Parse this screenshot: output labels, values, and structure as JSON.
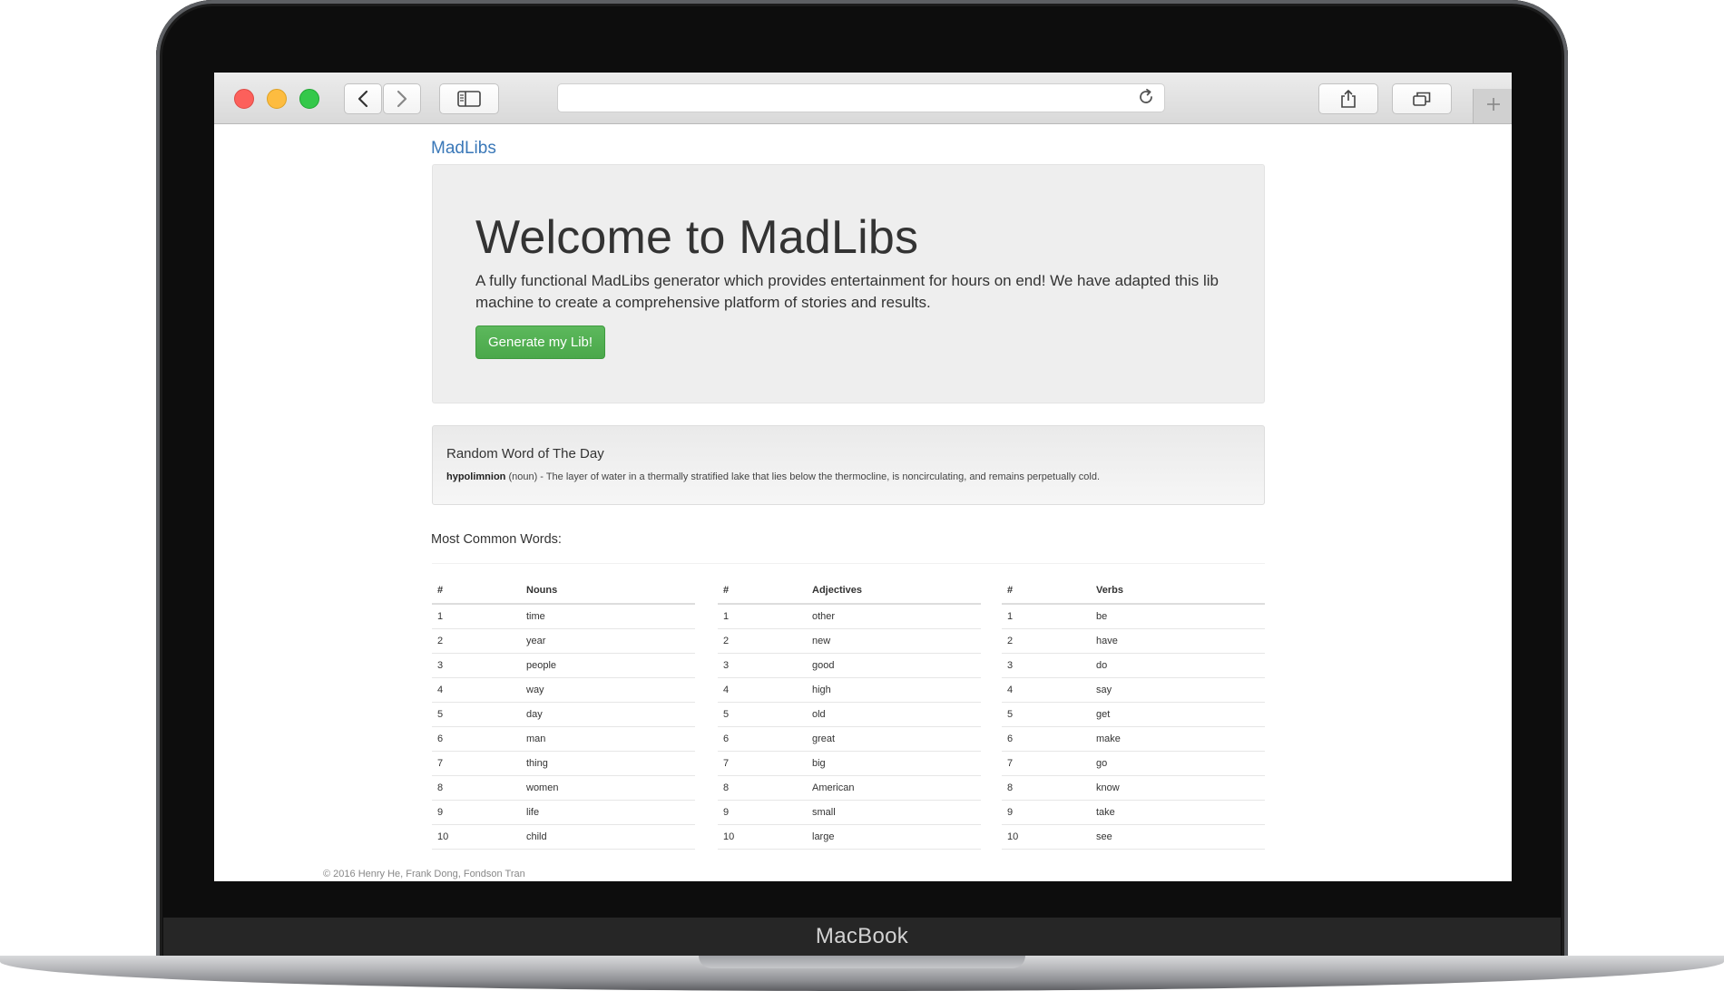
{
  "device": {
    "label": "MacBook"
  },
  "browser": {
    "url_value": "",
    "icons": {
      "back": "chevron-left-icon",
      "forward": "chevron-right-icon",
      "sidebar": "sidebar-icon",
      "reload": "reload-icon",
      "share": "share-icon",
      "tabs": "tabs-icon",
      "new_tab": "plus-icon"
    }
  },
  "nav": {
    "brand": "MadLibs"
  },
  "hero": {
    "title": "Welcome to MadLibs",
    "description": "A fully functional MadLibs generator which provides entertainment for hours on end! We have adapted this lib machine to create a comprehensive platform of stories and results.",
    "button_label": "Generate my Lib!",
    "button_color": "#5cb85c"
  },
  "word_of_day": {
    "title": "Random Word of The Day",
    "word": "hypolimnion",
    "definition": "(noun) - The layer of water in a thermally stratified lake that lies below the thermocline, is noncirculating, and remains perpetually cold."
  },
  "common_words": {
    "heading": "Most Common Words:",
    "tables": [
      {
        "num_header": "#",
        "word_header": "Nouns",
        "rows": [
          {
            "n": "1",
            "w": "time"
          },
          {
            "n": "2",
            "w": "year"
          },
          {
            "n": "3",
            "w": "people"
          },
          {
            "n": "4",
            "w": "way"
          },
          {
            "n": "5",
            "w": "day"
          },
          {
            "n": "6",
            "w": "man"
          },
          {
            "n": "7",
            "w": "thing"
          },
          {
            "n": "8",
            "w": "women"
          },
          {
            "n": "9",
            "w": "life"
          },
          {
            "n": "10",
            "w": "child"
          }
        ]
      },
      {
        "num_header": "#",
        "word_header": "Adjectives",
        "rows": [
          {
            "n": "1",
            "w": "other"
          },
          {
            "n": "2",
            "w": "new"
          },
          {
            "n": "3",
            "w": "good"
          },
          {
            "n": "4",
            "w": "high"
          },
          {
            "n": "5",
            "w": "old"
          },
          {
            "n": "6",
            "w": "great"
          },
          {
            "n": "7",
            "w": "big"
          },
          {
            "n": "8",
            "w": "American"
          },
          {
            "n": "9",
            "w": "small"
          },
          {
            "n": "10",
            "w": "large"
          }
        ]
      },
      {
        "num_header": "#",
        "word_header": "Verbs",
        "rows": [
          {
            "n": "1",
            "w": "be"
          },
          {
            "n": "2",
            "w": "have"
          },
          {
            "n": "3",
            "w": "do"
          },
          {
            "n": "4",
            "w": "say"
          },
          {
            "n": "5",
            "w": "get"
          },
          {
            "n": "6",
            "w": "make"
          },
          {
            "n": "7",
            "w": "go"
          },
          {
            "n": "8",
            "w": "know"
          },
          {
            "n": "9",
            "w": "take"
          },
          {
            "n": "10",
            "w": "see"
          }
        ]
      }
    ]
  },
  "footer": {
    "text": "© 2016 Henry He, Frank Dong, Fondson Tran"
  }
}
